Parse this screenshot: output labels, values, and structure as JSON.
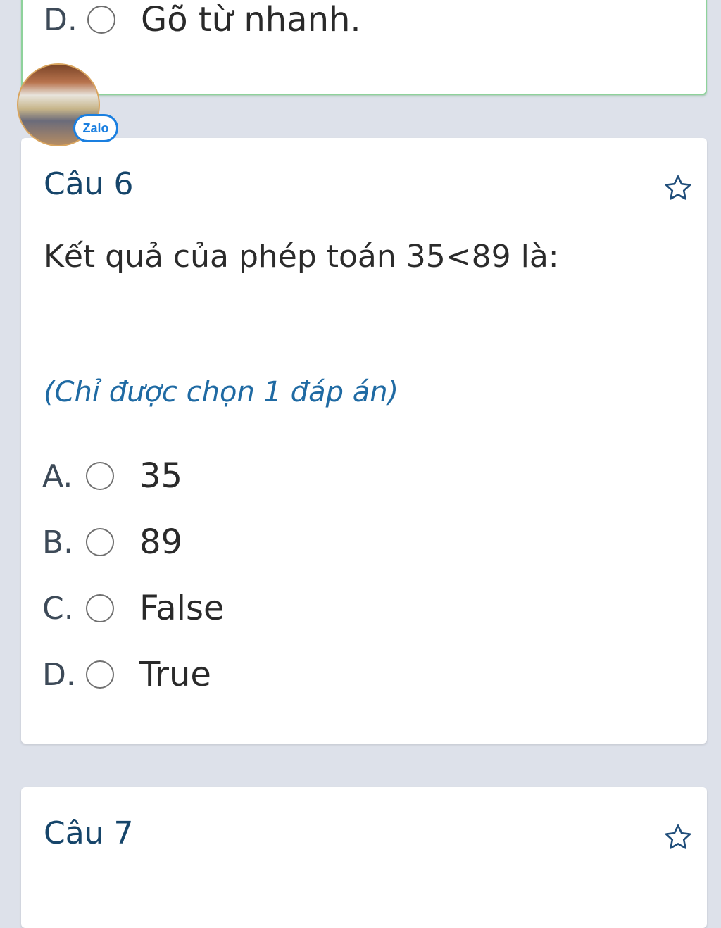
{
  "previous_question": {
    "option_d": {
      "letter": "D.",
      "text": "Gõ từ nhanh."
    }
  },
  "floating_widget": {
    "badge_label": "Zalo",
    "accent": "#1a7fe0"
  },
  "question6": {
    "title": "Câu 6",
    "text": "Kết quả của phép toán 35<89 là:",
    "hint": "(Chỉ được chọn 1 đáp án)",
    "options": [
      {
        "letter": "A.",
        "text": "35"
      },
      {
        "letter": "B.",
        "text": "89"
      },
      {
        "letter": "C.",
        "text": "False"
      },
      {
        "letter": "D.",
        "text": "True"
      }
    ]
  },
  "question7": {
    "title": "Câu 7"
  },
  "colors": {
    "title": "#16456a",
    "hint": "#1f6aa3",
    "answered_border": "#8ed29b",
    "background": "#dde1ea"
  }
}
